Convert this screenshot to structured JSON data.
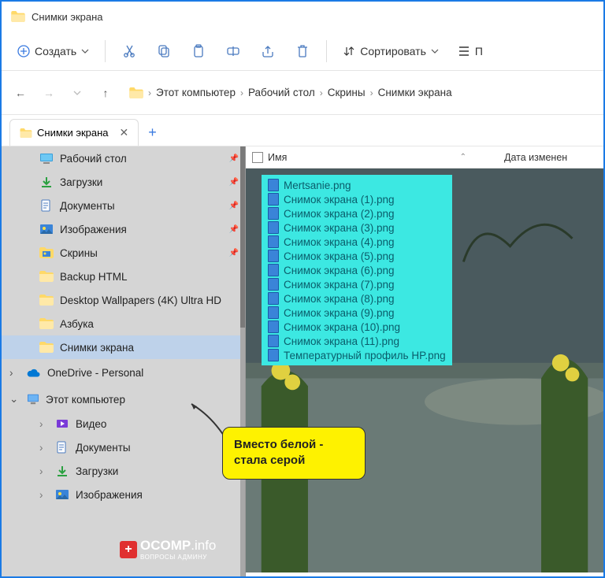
{
  "window": {
    "title": "Снимки экрана"
  },
  "toolbar": {
    "new_label": "Создать",
    "sort_label": "Сортировать",
    "view_label": "П"
  },
  "breadcrumb": {
    "items": [
      "Этот компьютер",
      "Рабочий стол",
      "Скрины",
      "Снимки экрана"
    ]
  },
  "tab": {
    "label": "Снимки экрана"
  },
  "sidebar": {
    "items": [
      {
        "label": "Рабочий стол",
        "icon": "desktop",
        "pin": true
      },
      {
        "label": "Загрузки",
        "icon": "download",
        "pin": true
      },
      {
        "label": "Документы",
        "icon": "document",
        "pin": true
      },
      {
        "label": "Изображения",
        "icon": "pictures",
        "pin": true
      },
      {
        "label": "Скрины",
        "icon": "folder-img",
        "pin": true
      },
      {
        "label": "Backup HTML",
        "icon": "folder",
        "pin": false
      },
      {
        "label": "Desktop Wallpapers (4K) Ultra HD",
        "icon": "folder",
        "pin": false
      },
      {
        "label": "Азбука",
        "icon": "folder",
        "pin": false
      },
      {
        "label": "Снимки экрана",
        "icon": "folder",
        "pin": false,
        "selected": true
      }
    ],
    "onedrive": "OneDrive - Personal",
    "thispc": "Этот компьютер",
    "pc_items": [
      {
        "label": "Видео",
        "icon": "video"
      },
      {
        "label": "Документы",
        "icon": "document"
      },
      {
        "label": "Загрузки",
        "icon": "download"
      },
      {
        "label": "Изображения",
        "icon": "pictures"
      }
    ]
  },
  "columns": {
    "name": "Имя",
    "date": "Дата изменен"
  },
  "files": [
    "Mertsanie.png",
    "Снимок экрана (1).png",
    "Снимок экрана (2).png",
    "Снимок экрана (3).png",
    "Снимок экрана (4).png",
    "Снимок экрана (5).png",
    "Снимок экрана (6).png",
    "Снимок экрана (7).png",
    "Снимок экрана (8).png",
    "Снимок экрана (9).png",
    "Снимок экрана (10).png",
    "Снимок экрана (11).png",
    "Температурный профиль HP.png"
  ],
  "callout": {
    "text": "Вместо белой - стала серой"
  },
  "logo": {
    "brand": "OCOMP",
    "tld": ".info",
    "sub": "ВОПРОСЫ АДМИНУ"
  }
}
